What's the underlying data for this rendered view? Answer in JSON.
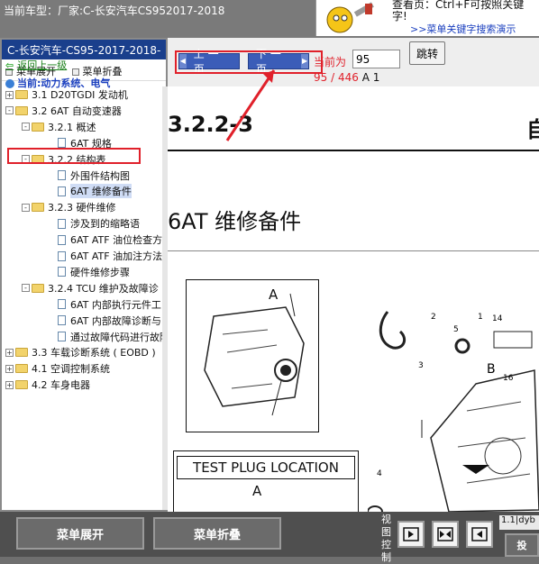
{
  "topbar": {
    "vehicle_title": "当前车型：厂家:C-长安汽车CS952017-2018",
    "promo_line1": "查看页：Ctrl+F可按照关键",
    "promo_line2": "字!",
    "promo_link": ">>菜单关键字搜索演示"
  },
  "left": {
    "header": "C-长安汽车-CS95-2017-2018-",
    "expand_label": "菜单展开",
    "collapse_label": "菜单折叠",
    "back_link": "返回上一级",
    "current_location": "当前:动力系统、电气"
  },
  "tree": [
    {
      "label": "3.1 D20TGDI 发动机",
      "kind": "folder",
      "level": 0,
      "exp": "+"
    },
    {
      "label": "3.2 6AT 自动变速器",
      "kind": "folder",
      "level": 0,
      "exp": "-"
    },
    {
      "label": "3.2.1 概述",
      "kind": "folder",
      "level": 1,
      "exp": "-"
    },
    {
      "label": "6AT 规格",
      "kind": "doc",
      "level": 2
    },
    {
      "label": "3.2.2 结构表",
      "kind": "folder",
      "level": 1,
      "exp": "-"
    },
    {
      "label": "外围件结构图",
      "kind": "doc",
      "level": 2
    },
    {
      "label": "6AT 维修备件",
      "kind": "doc",
      "level": 2,
      "selected": true
    },
    {
      "label": "3.2.3 硬件维修",
      "kind": "folder",
      "level": 1,
      "exp": "-"
    },
    {
      "label": "涉及到的缩略语",
      "kind": "doc",
      "level": 2
    },
    {
      "label": "6AT ATF 油位检查方",
      "kind": "doc",
      "level": 2
    },
    {
      "label": "6AT ATF 油加注方法",
      "kind": "doc",
      "level": 2
    },
    {
      "label": "硬件维修步骤",
      "kind": "doc",
      "level": 2
    },
    {
      "label": "3.2.4 TCU 维护及故障诊",
      "kind": "folder",
      "level": 1,
      "exp": "-"
    },
    {
      "label": "6AT 内部执行元件工",
      "kind": "doc",
      "level": 2
    },
    {
      "label": "6AT 内部故障诊断与",
      "kind": "doc",
      "level": 2
    },
    {
      "label": "通过故障代码进行故障",
      "kind": "doc",
      "level": 2
    },
    {
      "label": "3.3 车载诊断系统 ( EOBD )",
      "kind": "folder",
      "level": 0,
      "exp": "+"
    },
    {
      "label": "4.1 空调控制系统",
      "kind": "folder",
      "level": 0,
      "exp": "+"
    },
    {
      "label": "4.2 车身电器",
      "kind": "folder",
      "level": 0,
      "exp": "+"
    }
  ],
  "toolbar": {
    "prev_label": "上 一 页",
    "next_label": "下 一 页",
    "page_label": "当前为",
    "page_value": "95",
    "jump_label": "跳转",
    "page_count": "95 / 446",
    "page_section": "A 1"
  },
  "doc": {
    "section": "3.2.2-3",
    "side_char": "自",
    "title": "6AT 维修备件",
    "fig_label": "A",
    "test_plug": "TEST PLUG LOCATION",
    "fig_label2": "A",
    "callouts": [
      "1",
      "2",
      "3",
      "4",
      "5",
      "14",
      "16",
      "B"
    ]
  },
  "bottom": {
    "expand": "菜单展开",
    "collapse": "菜单折叠",
    "view_ctl": "视图控制",
    "status": "1.1|dyb",
    "status_btn": "投"
  },
  "colors": {
    "accent_red": "#e0202a",
    "nav_blue": "#3b5db8",
    "header_blue": "#1a3f8c"
  }
}
